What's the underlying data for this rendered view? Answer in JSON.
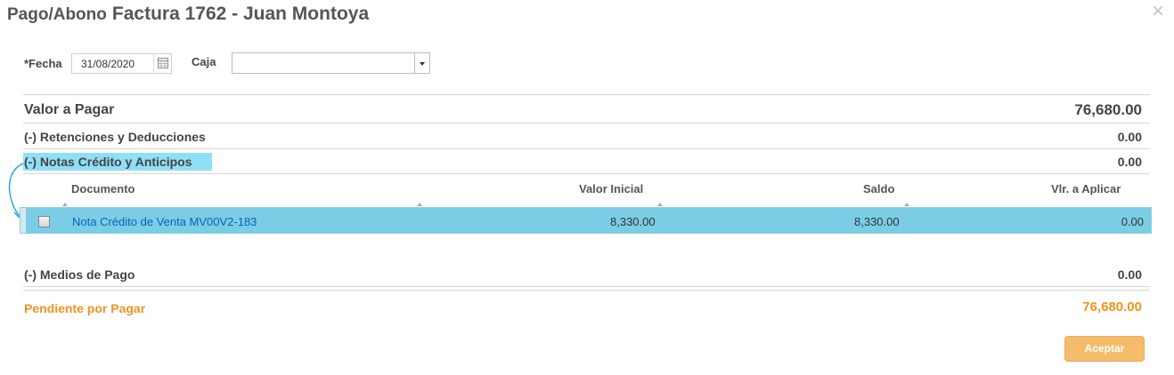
{
  "header": {
    "title_prefix": "Pago/Abono",
    "title_main": "Factura 1762 - Juan Montoya",
    "close_glyph": "×"
  },
  "form": {
    "fecha_label": "*Fecha",
    "fecha_value": "31/08/2020",
    "caja_label": "Caja",
    "caja_value": ""
  },
  "summary": {
    "valor_label": "Valor a Pagar",
    "valor_value": "76,680.00",
    "retenciones_label": "(-) Retenciones y Deducciones",
    "retenciones_value": "0.00",
    "notas_label": "(-) Notas Crédito y Anticipos",
    "notas_value": "0.00",
    "medios_label": "(-) Medios de Pago",
    "medios_value": "0.00",
    "pendiente_label": "Pendiente por Pagar",
    "pendiente_value": "76,680.00"
  },
  "table": {
    "columns": [
      "Documento",
      "Valor Inicial",
      "Saldo",
      "Vlr. a Aplicar"
    ],
    "rows": [
      {
        "documento": "Nota Crédito de Venta MV00V2-183",
        "valor_inicial": "8,330.00",
        "saldo": "8,330.00",
        "vlr_aplicar": "0.00",
        "checked": false
      }
    ]
  },
  "actions": {
    "accept_label": "Aceptar"
  },
  "colors": {
    "accent_orange": "#f0931e",
    "button_orange": "#f6bc6a",
    "row_highlight": "#7bcde6",
    "label_highlight": "#8fdff7",
    "link_blue": "#0a62b8",
    "annotation_arrow": "#2ba8e0"
  },
  "icons": {
    "calendar": "calendar-icon",
    "dropdown": "chevron-down-icon",
    "close": "close-icon",
    "annotation": "curved-arrow-icon"
  }
}
